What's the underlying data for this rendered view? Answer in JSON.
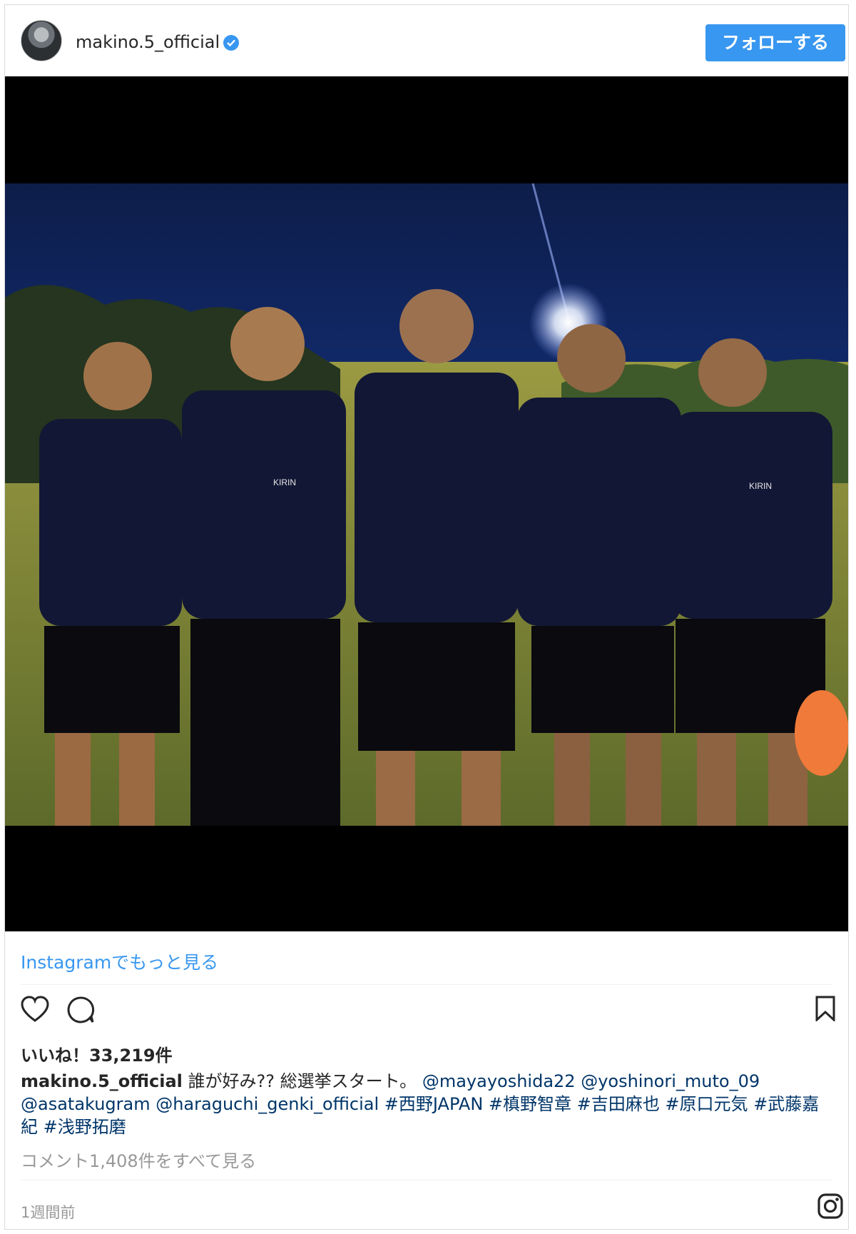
{
  "post": {
    "username": "makino.5_official",
    "follow_label": "フォローする",
    "more_link": "Instagramでもっと見る",
    "likes": "いいね！33,219件",
    "caption_user": "makino.5_official",
    "caption_text": "誰が好み?? 総選挙スタート。",
    "mentions": "@mayayoshida22 @yoshinori_muto_09 @asatakugram @haraguchi_genki_official",
    "hashtags": "#西野JAPAN #槙野智章 #吉田麻也 #原口元気 #武藤嘉紀 #浅野拓磨",
    "comments_link": "コメント1,408件をすべて見る",
    "timestamp": "1週間前"
  },
  "photo": {
    "jersey_text": "KIRIN"
  },
  "colors": {
    "accent": "#3897f0",
    "secondary_text": "#999999",
    "link": "#003569"
  },
  "icons": [
    "verified-badge-icon",
    "heart-icon",
    "comment-icon",
    "bookmark-icon",
    "instagram-icon"
  ]
}
